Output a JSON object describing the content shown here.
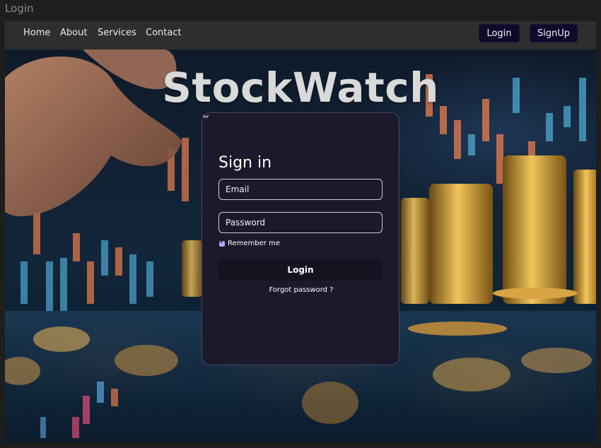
{
  "window": {
    "title": "Login"
  },
  "nav": {
    "links": [
      "Home",
      "About",
      "Services",
      "Contact"
    ],
    "login_label": "Login",
    "signup_label": "SignUp"
  },
  "hero": {
    "brand": "StockWatch"
  },
  "signin": {
    "title": "Sign in",
    "email_placeholder": "Email",
    "password_placeholder": "Password",
    "remember_label": "Remember me",
    "remember_checked": true,
    "login_label": "Login",
    "forgot_label": "Forgot password ?"
  },
  "icons": {
    "password_toggle": "eye-closed-icon",
    "remember_checkbox": "check-icon"
  },
  "colors": {
    "navbar_bg": "#2e2e2e",
    "nav_button_bg": "#11092a",
    "card_bg": "#1c192b",
    "checkbox_accent": "#a9a7f0"
  }
}
